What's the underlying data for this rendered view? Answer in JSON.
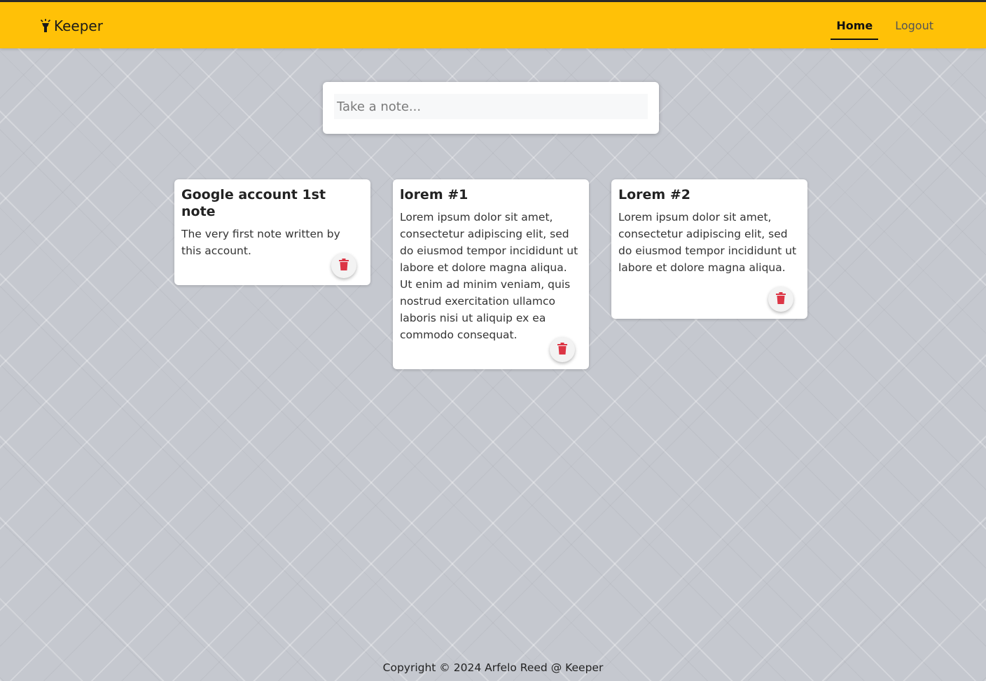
{
  "header": {
    "brand_icon": "flashlight-icon",
    "brand_name": "Keeper",
    "accent_color": "#ffc107",
    "nav": [
      {
        "label": "Home",
        "active": true
      },
      {
        "label": "Logout",
        "active": false
      }
    ]
  },
  "create_note": {
    "placeholder": "Take a note..."
  },
  "notes": [
    {
      "title": "Google account 1st note",
      "content": "The very first note written by this account.",
      "delete_icon": "trash-icon"
    },
    {
      "title": "lorem #1",
      "content": "Lorem ipsum dolor sit amet, consectetur adipiscing elit, sed do eiusmod tempor incididunt ut labore et dolore magna aliqua. Ut enim ad minim veniam, quis nostrud exercitation ullamco laboris nisi ut aliquip ex ea commodo consequat.",
      "delete_icon": "trash-icon"
    },
    {
      "title": "Lorem #2",
      "content": "Lorem ipsum dolor sit amet, consectetur adipiscing elit, sed do eiusmod tempor incididunt ut labore et dolore magna aliqua.",
      "delete_icon": "trash-icon"
    }
  ],
  "delete_color": "#dc3545",
  "footer": {
    "text": "Copyright © 2024 Arfelo Reed @ Keeper"
  }
}
